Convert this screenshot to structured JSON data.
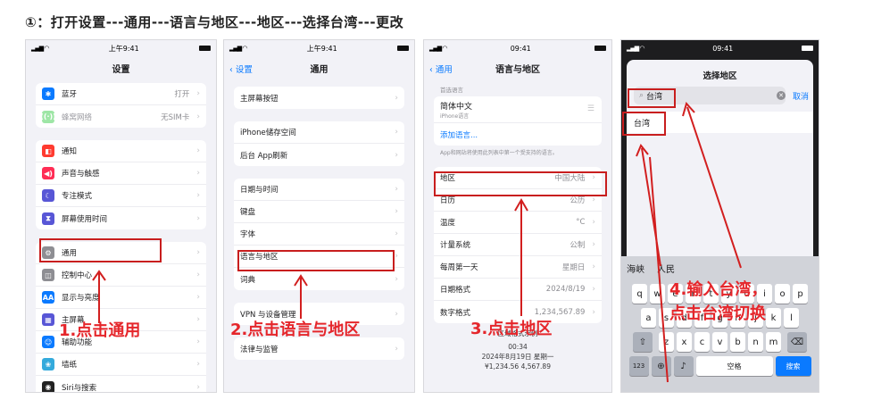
{
  "title": "①：打开设置---通用---语言与地区---地区---选择台湾---更改",
  "phone1": {
    "status": {
      "time": "上午9:41"
    },
    "nav_title": "设置",
    "groups": [
      [
        {
          "name": "bluetooth",
          "icon": "bluetooth-icon",
          "color": "#0a7aff",
          "glyph": "✱",
          "label": "蓝牙",
          "value": "打开"
        },
        {
          "name": "cellular",
          "icon": "cellular-icon",
          "color": "#9ee6a6",
          "glyph": "((·))",
          "label": "蜂窝网络",
          "value": "无SIM卡",
          "dim": true
        }
      ],
      [
        {
          "name": "notifications",
          "icon": "bell-icon",
          "color": "#ff3b30",
          "glyph": "◧",
          "label": "通知",
          "value": ""
        },
        {
          "name": "sounds",
          "icon": "speaker-icon",
          "color": "#ff2d55",
          "glyph": "◀)",
          "label": "声音与触感",
          "value": ""
        },
        {
          "name": "focus",
          "icon": "moon-icon",
          "color": "#5856d6",
          "glyph": "☾",
          "label": "专注模式",
          "value": ""
        },
        {
          "name": "screentime",
          "icon": "hourglass-icon",
          "color": "#5856d6",
          "glyph": "⧗",
          "label": "屏幕使用时间",
          "value": ""
        }
      ],
      [
        {
          "name": "general",
          "icon": "gear-icon",
          "color": "#8e8e93",
          "glyph": "⚙",
          "label": "通用",
          "value": ""
        },
        {
          "name": "control-center",
          "icon": "sliders-icon",
          "color": "#8e8e93",
          "glyph": "◫",
          "label": "控制中心",
          "value": ""
        },
        {
          "name": "display",
          "icon": "text-size-icon",
          "color": "#0a7aff",
          "glyph": "AA",
          "label": "显示与亮度",
          "value": ""
        },
        {
          "name": "home-screen",
          "icon": "grid-icon",
          "color": "#5856d6",
          "glyph": "▦",
          "label": "主屏幕",
          "value": ""
        },
        {
          "name": "accessibility",
          "icon": "accessibility-icon",
          "color": "#0a7aff",
          "glyph": "☺",
          "label": "辅助功能",
          "value": ""
        },
        {
          "name": "wallpaper",
          "icon": "flower-icon",
          "color": "#34aadc",
          "glyph": "❀",
          "label": "墙纸",
          "value": ""
        },
        {
          "name": "siri",
          "icon": "siri-icon",
          "color": "#222222",
          "glyph": "◉",
          "label": "Siri与搜索",
          "value": ""
        }
      ]
    ],
    "caption": "1.点击通用"
  },
  "phone2": {
    "status": {
      "time": "上午9:41"
    },
    "back": "‹ 设置",
    "nav_title": "通用",
    "groups": [
      [
        {
          "label": "主屏幕按钮"
        }
      ],
      [
        {
          "label": "iPhone储存空间"
        },
        {
          "label": "后台 App刷新"
        }
      ],
      [
        {
          "label": "日期与时间"
        },
        {
          "label": "键盘"
        },
        {
          "label": "字体"
        },
        {
          "label": "语言与地区"
        },
        {
          "label": "词典"
        }
      ],
      [
        {
          "label": "VPN 与设备管理"
        }
      ],
      [
        {
          "label": "法律与监管"
        }
      ]
    ],
    "caption": "2.点击语言与地区"
  },
  "phone3": {
    "status": {
      "time": "09:41"
    },
    "back": "‹ 通用",
    "nav_title": "语言与地区",
    "pref_header": "首选语言",
    "lang_main": "简体中文",
    "lang_sub": "iPhone语言",
    "add_lang": "添加语言...",
    "note": "App和网站将使用此列表中第一个受支持的语言。",
    "rows": [
      {
        "label": "地区",
        "value": "中国大陆"
      },
      {
        "label": "日历",
        "value": "公历"
      },
      {
        "label": "温度",
        "value": "°C"
      },
      {
        "label": "计量系统",
        "value": "公制"
      },
      {
        "label": "每周第一天",
        "value": "星期日"
      },
      {
        "label": "日期格式",
        "value": "2024/8/19"
      },
      {
        "label": "数字格式",
        "value": "1,234,567.89"
      }
    ],
    "example_header": "区域格式示例",
    "example_time": "00:34",
    "example_date": "2024年8月19日 星期一",
    "example_num": "¥1,234.56   4,567.89",
    "caption": "3.点击地区"
  },
  "phone4": {
    "status": {
      "time": "09:41"
    },
    "nav_title": "选择地区",
    "search_value": "台湾",
    "cancel": "取消",
    "result": "台湾",
    "candidates": [
      "海峡",
      "人民"
    ],
    "keys_row1": [
      "q",
      "w",
      "e",
      "r",
      "t",
      "y",
      "u",
      "i",
      "o",
      "p"
    ],
    "keys_row2": [
      "a",
      "s",
      "d",
      "f",
      "g",
      "h",
      "j",
      "k",
      "l"
    ],
    "keys_row3": [
      "z",
      "x",
      "c",
      "v",
      "b",
      "n",
      "m"
    ],
    "key_123": "123",
    "key_space": "空格",
    "key_search": "搜索",
    "caption_line1": "4.输入台湾，",
    "caption_line2": "点击台湾切换"
  }
}
